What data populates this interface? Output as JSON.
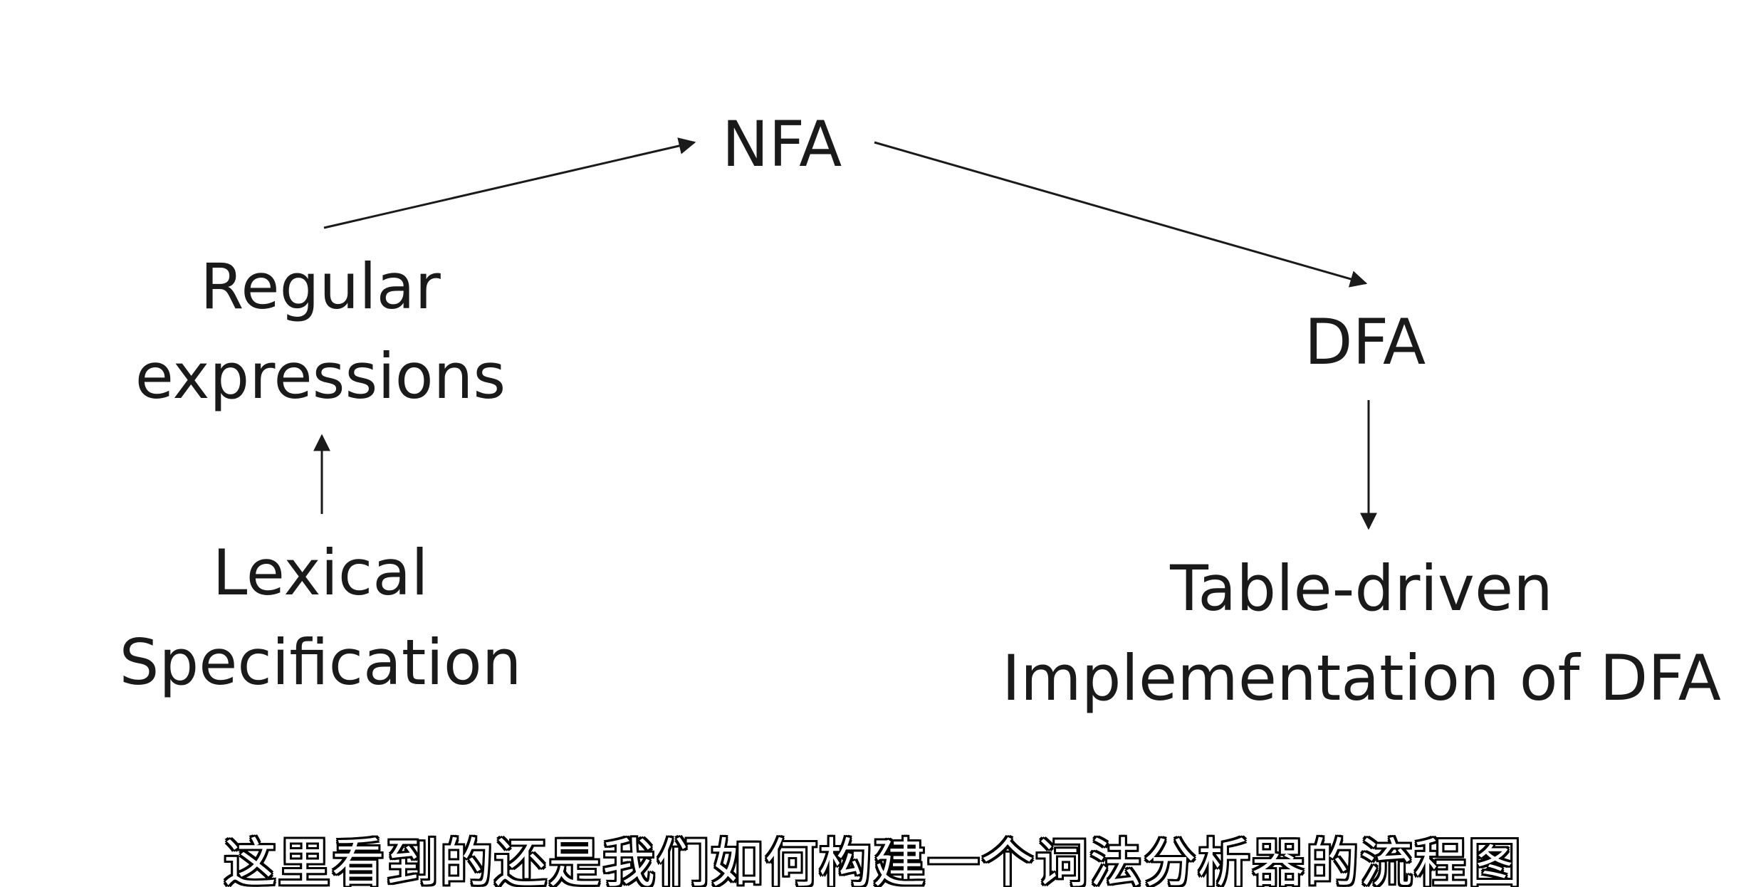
{
  "diagram": {
    "nodes": {
      "nfa": "NFA",
      "regular_expressions": [
        "Regular",
        "expressions"
      ],
      "dfa": "DFA",
      "lexical_specification": [
        "Lexical",
        "Specification"
      ],
      "table_driven": [
        "Table-driven",
        "Implementation of DFA"
      ]
    },
    "edges": [
      {
        "from": "lexical_specification",
        "to": "regular_expressions"
      },
      {
        "from": "regular_expressions",
        "to": "nfa"
      },
      {
        "from": "nfa",
        "to": "dfa"
      },
      {
        "from": "dfa",
        "to": "table_driven"
      }
    ],
    "line_color": "#1a1a1a"
  },
  "subtitle": "这里看到的还是我们如何构建一个词法分析器的流程图"
}
